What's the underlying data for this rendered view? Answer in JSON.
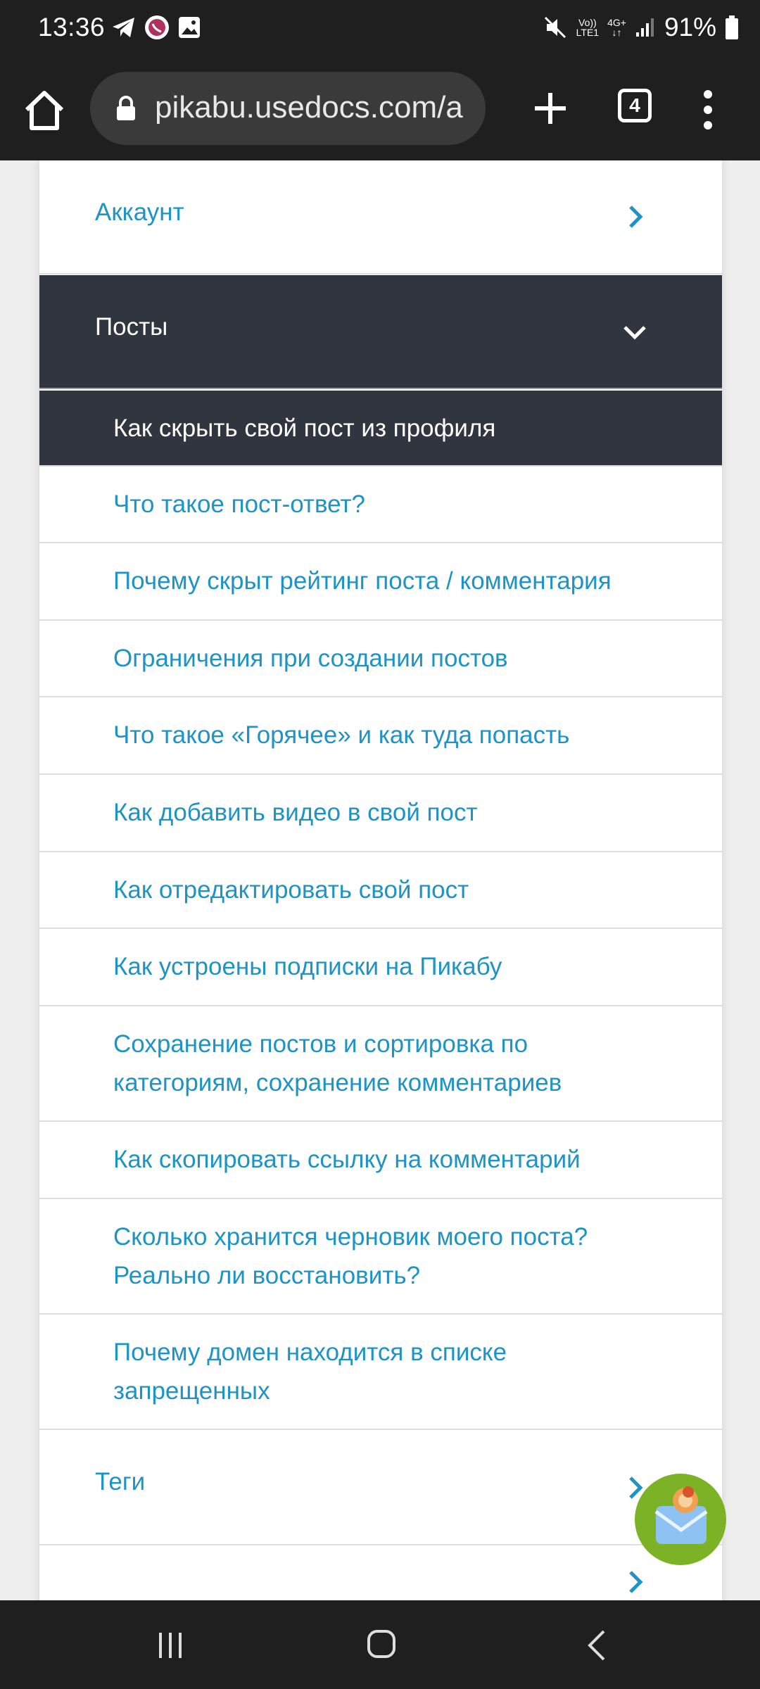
{
  "status_bar": {
    "time": "13:36",
    "network_top": "Vo))",
    "network_bottom": "LTE1",
    "network2_top": "4G+",
    "battery": "91%"
  },
  "browser": {
    "url": "pikabu.usedocs.com/a",
    "tab_count": "4"
  },
  "menu": {
    "account_label": "Аккаунт",
    "posts_label": "Посты",
    "tags_label": "Теги",
    "articles": [
      "Как скрыть свой пост из профиля",
      "Что такое пост-ответ?",
      "Почему скрыт рейтинг поста / комментария",
      "Ограничения при создании постов",
      "Что такое «Горячее» и как туда попасть",
      "Как добавить видео в свой пост",
      "Как отредактировать свой пост",
      "Как устроены подписки на Пикабу",
      "Сохранение постов и сортировка по категориям, сохранение комментариев",
      "Как скопировать ссылку на комментарий",
      "Сколько хранится черновик моего поста? Реально ли восстановить?",
      "Почему домен находится в списке запрещенных"
    ]
  },
  "colors": {
    "link": "#1d93c6",
    "active_bg": "#313540",
    "fab": "#7cb326"
  }
}
